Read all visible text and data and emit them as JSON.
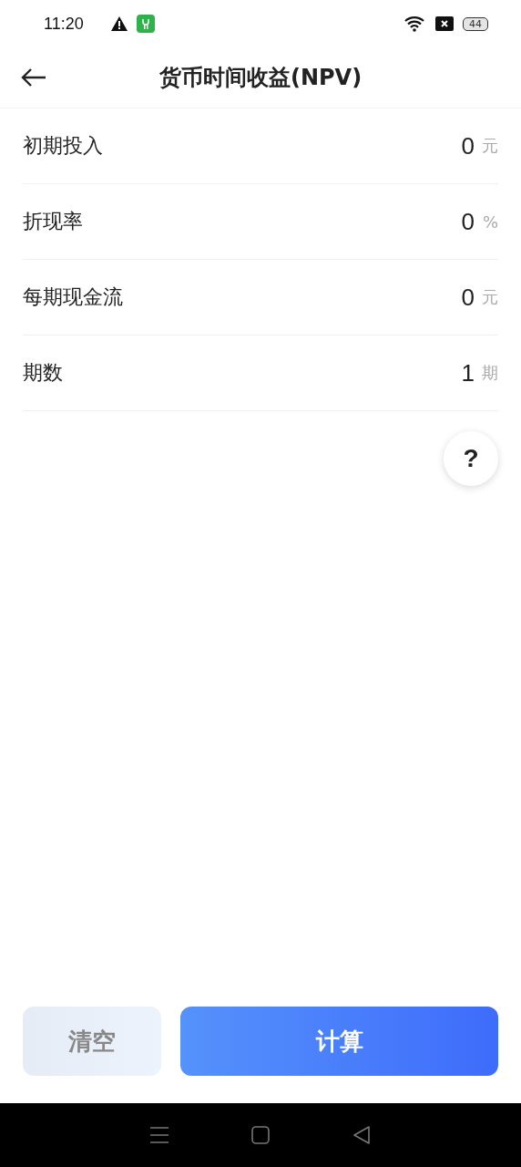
{
  "status_bar": {
    "time": "11:20",
    "battery": "44"
  },
  "header": {
    "title": "货币时间收益(NPV)"
  },
  "fields": [
    {
      "label": "初期投入",
      "value": "0",
      "unit": "元"
    },
    {
      "label": "折现率",
      "value": "0",
      "unit": "%"
    },
    {
      "label": "每期现金流",
      "value": "0",
      "unit": "元"
    },
    {
      "label": "期数",
      "value": "1",
      "unit": "期"
    }
  ],
  "help": {
    "label": "?"
  },
  "buttons": [
    {
      "kind": "secondary",
      "label": "清空"
    },
    {
      "kind": "primary",
      "label": "计算"
    }
  ]
}
